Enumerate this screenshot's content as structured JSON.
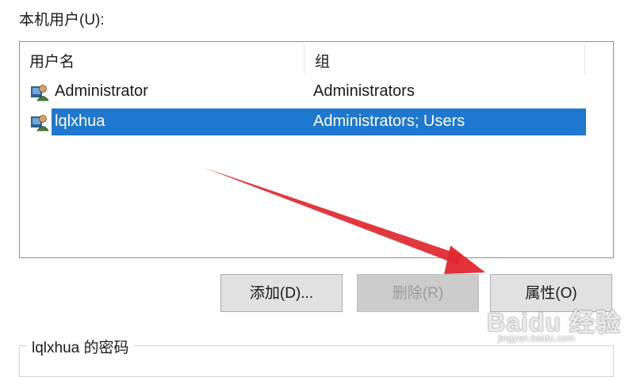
{
  "users_section": {
    "label": "本机用户(U):"
  },
  "user_list": {
    "columns": {
      "user": "用户名",
      "group": "组"
    },
    "rows": [
      {
        "user": "Administrator",
        "group": "Administrators",
        "selected": false,
        "icon": "user-account-icon"
      },
      {
        "user": "lqlxhua",
        "group": "Administrators; Users",
        "selected": true,
        "icon": "user-account-icon"
      }
    ],
    "selection_color": "#1f78cf"
  },
  "buttons": {
    "add": "添加(D)...",
    "remove": "删除(R)",
    "properties": "属性(O)"
  },
  "password_group": {
    "title": "lqlxhua 的密码"
  },
  "annotation": {
    "type": "red-arrow",
    "color": "#e0272c",
    "points_to": "properties-button"
  },
  "watermark": {
    "brand": "Baidu 经验",
    "url": "jingyan.baidu.com"
  }
}
